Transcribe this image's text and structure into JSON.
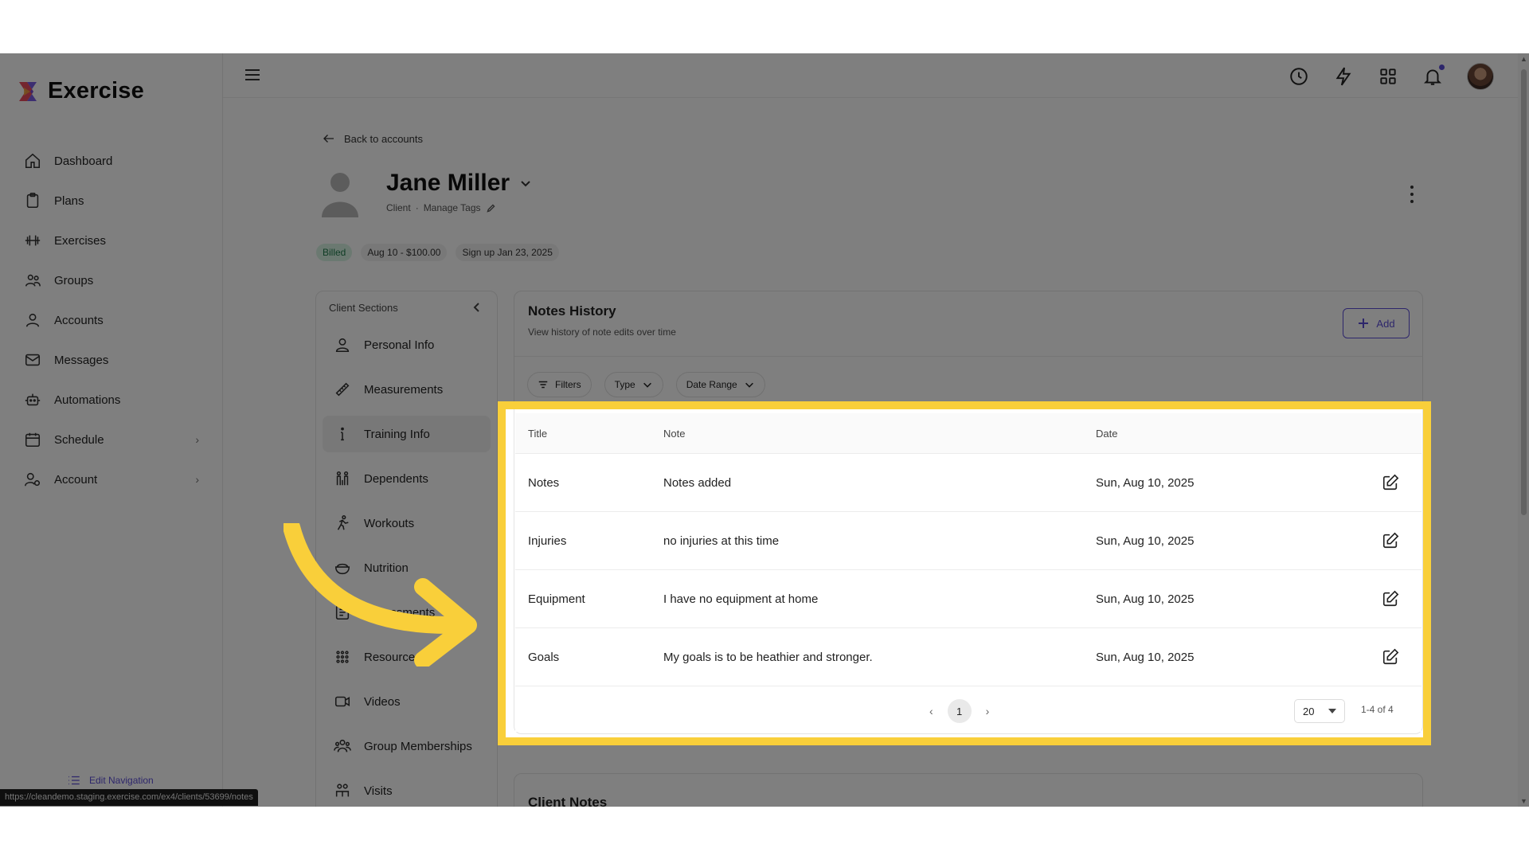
{
  "app": {
    "name": "Exercise"
  },
  "sidebar": {
    "items": [
      {
        "label": "Dashboard",
        "icon": "home-icon"
      },
      {
        "label": "Plans",
        "icon": "clipboard-icon"
      },
      {
        "label": "Exercises",
        "icon": "dumbbell-icon"
      },
      {
        "label": "Groups",
        "icon": "users-icon"
      },
      {
        "label": "Accounts",
        "icon": "user-icon"
      },
      {
        "label": "Messages",
        "icon": "mail-icon"
      },
      {
        "label": "Automations",
        "icon": "robot-icon"
      },
      {
        "label": "Schedule",
        "icon": "calendar-icon",
        "chevron": true
      },
      {
        "label": "Account",
        "icon": "user-gear-icon",
        "chevron": true
      }
    ],
    "edit_nav": "Edit Navigation"
  },
  "status_url": "https://cleandemo.staging.exercise.com/ex4/clients/53699/notes",
  "header": {
    "back_label": "Back to accounts",
    "client_name": "Jane Miller",
    "role": "Client",
    "separator": "·",
    "manage_tags": "Manage Tags",
    "pills": [
      {
        "label": "Billed",
        "tone": "green"
      },
      {
        "label": "Aug 10 - $100.00"
      },
      {
        "label": "Sign up Jan 23, 2025"
      }
    ]
  },
  "sections_panel": {
    "title": "Client Sections",
    "items": [
      {
        "label": "Personal Info",
        "icon": "person-icon"
      },
      {
        "label": "Measurements",
        "icon": "ruler-icon"
      },
      {
        "label": "Training Info",
        "icon": "info-icon",
        "active": true
      },
      {
        "label": "Dependents",
        "icon": "family-icon"
      },
      {
        "label": "Workouts",
        "icon": "running-icon"
      },
      {
        "label": "Nutrition",
        "icon": "bowl-icon"
      },
      {
        "label": "Assessments",
        "icon": "checklist-icon"
      },
      {
        "label": "Resources",
        "icon": "grid-dots-icon"
      },
      {
        "label": "Videos",
        "icon": "video-icon"
      },
      {
        "label": "Group Memberships",
        "icon": "group-icon"
      },
      {
        "label": "Visits",
        "icon": "visits-icon"
      }
    ]
  },
  "notes_history": {
    "title": "Notes History",
    "subtitle": "View history of note edits over time",
    "add_label": "Add",
    "filters": [
      {
        "label": "Filters",
        "icon": "filter-icon"
      },
      {
        "label": "Type",
        "icon": "chevron-down-icon"
      },
      {
        "label": "Date Range",
        "icon": "chevron-down-icon"
      }
    ],
    "columns": {
      "title": "Title",
      "note": "Note",
      "date": "Date"
    },
    "rows": [
      {
        "title": "Notes",
        "note": "Notes added",
        "date": "Sun, Aug 10, 2025"
      },
      {
        "title": "Injuries",
        "note": "no injuries at this time",
        "date": "Sun, Aug 10, 2025"
      },
      {
        "title": "Equipment",
        "note": "I have no equipment at home",
        "date": "Sun, Aug 10, 2025"
      },
      {
        "title": "Goals",
        "note": "My goals is to be heathier and stronger.",
        "date": "Sun, Aug 10, 2025"
      }
    ],
    "pagination": {
      "prev": "‹",
      "current_page": "1",
      "next": "›",
      "per_page": "20",
      "range": "1-4 of 4"
    }
  },
  "client_notes": {
    "title": "Client Notes"
  },
  "colors": {
    "accent": "#5b4cd6",
    "highlight": "#f9cf3a",
    "billed_bg": "#d7f3e3"
  }
}
